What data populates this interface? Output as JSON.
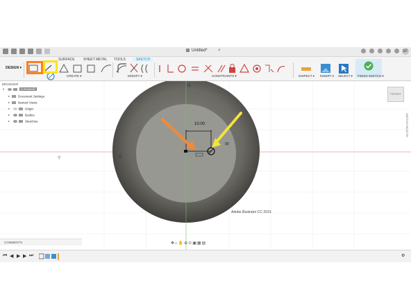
{
  "window": {
    "document_title": "Untitled*",
    "avatar_initials": "EF"
  },
  "ribbon": {
    "tabs": [
      "SURFACE",
      "SHEET METAL",
      "TOOLS",
      "SKETCH"
    ],
    "active_tab": "SKETCH",
    "workspace_button": "DESIGN ▾",
    "groups": {
      "create": "CREATE ▾",
      "modify": "MODIFY ▾",
      "constraints": "CONSTRAINTS ▾",
      "inspect": "INSPECT ▾",
      "insert": "INSERT ▾",
      "select": "SELECT ▾",
      "finish": "FINISH SKETCH ▾"
    }
  },
  "browser": {
    "header": "BROWSER",
    "root_tag": "(Unsaved)",
    "items": [
      "Document Settings",
      "Named Views",
      "Origin",
      "Bodies",
      "Sketches"
    ]
  },
  "canvas": {
    "dimension_label": "10.00",
    "dimension_label_2": "00",
    "axis_label_top": "N",
    "axis_label_left": "S",
    "viewcube_label": "FRONT",
    "sketch_palette_label": "SKETCH PALETTE"
  },
  "comments": {
    "label": "COMMENTS"
  },
  "footer": {
    "watermark": "Adobe Illustrator CC 2019"
  },
  "annotations": {
    "highlight_colors": {
      "orange": "#ff7f1e",
      "yellow": "#ffe21a"
    },
    "arrow_colors": {
      "orange": "#f28a36",
      "yellow": "#f2e33a"
    }
  }
}
